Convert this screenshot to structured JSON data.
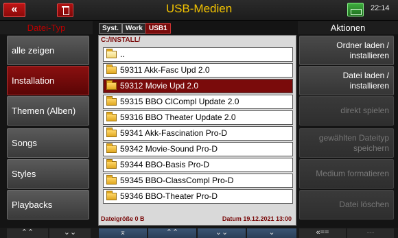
{
  "header": {
    "back_icon": "double-left-arrow-icon",
    "trash_icon": "trash-icon",
    "title": "USB-Medien",
    "time": "22:14"
  },
  "left_panel": {
    "header": "Datei-Typ",
    "items": [
      {
        "label": "alle zeigen",
        "active": false
      },
      {
        "label": "Installation",
        "active": true
      },
      {
        "label": "Themen (Alben)",
        "active": false
      },
      {
        "label": "Songs",
        "active": false
      },
      {
        "label": "Styles",
        "active": false
      },
      {
        "label": "Playbacks",
        "active": false
      }
    ]
  },
  "tabs": [
    {
      "label": "Syst.",
      "active": false
    },
    {
      "label": "Work",
      "active": false
    },
    {
      "label": "USB1",
      "active": true
    }
  ],
  "browser": {
    "path": "C:/INSTALL/",
    "rows": [
      {
        "label": "..",
        "type": "parent-folder",
        "selected": false
      },
      {
        "label": "59311 Akk-Fasc Upd 2.0",
        "type": "folder",
        "selected": false
      },
      {
        "label": "59312 Movie Upd 2.0",
        "type": "folder",
        "selected": true
      },
      {
        "label": "59315 BBO ClCompl Update 2.0",
        "type": "folder",
        "selected": false
      },
      {
        "label": "59316 BBO Theater Update 2.0",
        "type": "folder",
        "selected": false
      },
      {
        "label": "59341 Akk-Fascination Pro-D",
        "type": "folder",
        "selected": false
      },
      {
        "label": "59342 Movie-Sound Pro-D",
        "type": "folder",
        "selected": false
      },
      {
        "label": "59344 BBO-Basis Pro-D",
        "type": "folder",
        "selected": false
      },
      {
        "label": "59345 BBO-ClassCompl Pro-D",
        "type": "folder",
        "selected": false
      },
      {
        "label": "59346 BBO-Theater Pro-D",
        "type": "folder",
        "selected": false
      }
    ],
    "file_size": "Dateigröße 0 B",
    "date": "Datum 19.12.2021 13:00"
  },
  "right_panel": {
    "header": "Aktionen",
    "buttons": [
      {
        "label": "Ordner laden / installieren",
        "enabled": true
      },
      {
        "label": "Datei laden / installieren",
        "enabled": true
      },
      {
        "label": "direkt spielen",
        "enabled": false
      },
      {
        "label": "gewählten Dateityp speichern",
        "enabled": false
      },
      {
        "label": "Medium formatieren",
        "enabled": false
      },
      {
        "label": "Datei löschen",
        "enabled": false
      }
    ]
  },
  "bottom_bar": {
    "left_up": "≈",
    "left_down": "≈",
    "page_up": "⌃",
    "scroll_up": "≈",
    "scroll_down": "≈",
    "page_down": "⌄",
    "back": "«==",
    "blank": "---"
  },
  "colors": {
    "title": "#f4c400",
    "selected_row": "#7a0b0b",
    "active_button": "#8a1010",
    "path_text": "#7a0a0a"
  }
}
